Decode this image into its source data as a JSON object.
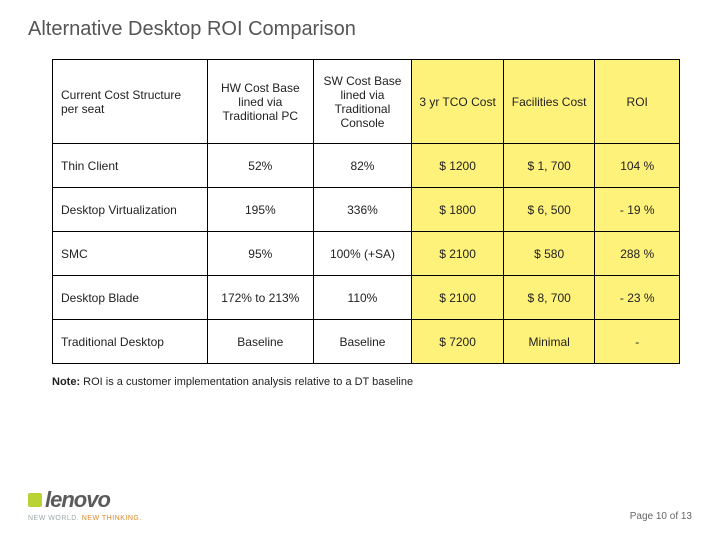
{
  "title": "Alternative Desktop ROI Comparison",
  "headers": {
    "c0": "Current Cost Structure per seat",
    "c1": "HW Cost Base lined via Traditional PC",
    "c2": "SW Cost Base lined via Traditional Console",
    "c3": "3 yr TCO Cost",
    "c4": "Facilities Cost",
    "c5": "ROI"
  },
  "rows": [
    {
      "name": "Thin Client",
      "hw": "52%",
      "sw": "82%",
      "tco": "$  1200",
      "fac": "$ 1, 700",
      "roi": "104 %"
    },
    {
      "name": "Desktop Virtualization",
      "hw": "195%",
      "sw": "336%",
      "tco": "$  1800",
      "fac": "$ 6, 500",
      "roi": "- 19 %"
    },
    {
      "name": "SMC",
      "hw": "95%",
      "sw": "100% (+SA)",
      "tco": "$  2100",
      "fac": "$    580",
      "roi": "288 %"
    },
    {
      "name": "Desktop Blade",
      "hw": "172% to 213%",
      "sw": "110%",
      "tco": "$  2100",
      "fac": "$ 8, 700",
      "roi": "- 23 %"
    },
    {
      "name": "Traditional Desktop",
      "hw": "Baseline",
      "sw": "Baseline",
      "tco": "$ 7200",
      "fac": "Minimal",
      "roi": "-"
    }
  ],
  "note_label": "Note:",
  "note_text": "ROI is a customer implementation analysis relative to a DT baseline",
  "logo": {
    "text": "lenovo",
    "sub1": "NEW WORLD.",
    "sub2": "NEW THINKING."
  },
  "page": "Page 10 of 13",
  "chart_data": {
    "type": "table",
    "title": "Alternative Desktop ROI Comparison",
    "columns": [
      "Current Cost Structure per seat",
      "HW Cost Base lined via Traditional PC",
      "SW Cost Base lined via Traditional Console",
      "3 yr TCO Cost",
      "Facilities Cost",
      "ROI"
    ],
    "rows": [
      [
        "Thin Client",
        "52%",
        "82%",
        "$ 1200",
        "$ 1,700",
        "104 %"
      ],
      [
        "Desktop Virtualization",
        "195%",
        "336%",
        "$ 1800",
        "$ 6,500",
        "-19 %"
      ],
      [
        "SMC",
        "95%",
        "100% (+SA)",
        "$ 2100",
        "$ 580",
        "288 %"
      ],
      [
        "Desktop Blade",
        "172% to 213%",
        "110%",
        "$ 2100",
        "$ 8,700",
        "-23 %"
      ],
      [
        "Traditional Desktop",
        "Baseline",
        "Baseline",
        "$ 7200",
        "Minimal",
        "-"
      ]
    ]
  }
}
